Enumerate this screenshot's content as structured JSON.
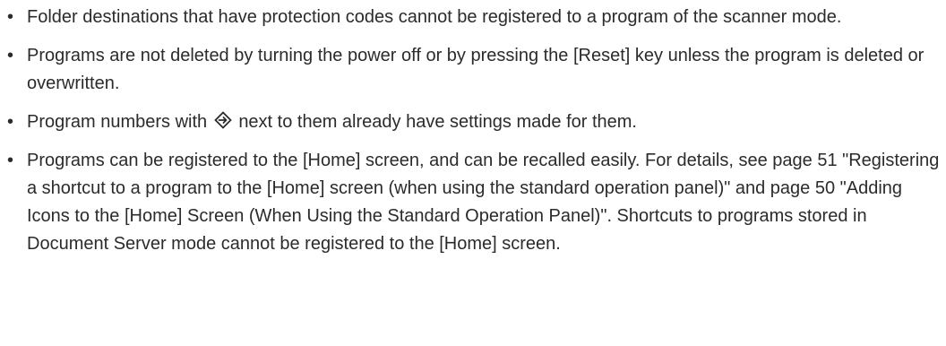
{
  "notes": [
    "Folder destinations that have protection codes cannot be registered to a program of the scanner mode.",
    "Programs are not deleted by turning the power off or by pressing the [Reset] key unless the program is deleted or overwritten.",
    {
      "before": "Program numbers with",
      "icon": "program-registered-icon",
      "after": "next to them already have settings made for them."
    },
    "Programs can be registered to the [Home] screen, and can be recalled easily. For details, see page 51 \"Registering a shortcut to a program to the [Home] screen (when using the standard operation panel)\" and page 50 \"Adding Icons to the [Home] Screen (When Using the Standard Operation Panel)\". Shortcuts to programs stored in Document Server mode cannot be registered to the [Home] screen."
  ],
  "bullet_glyph": "•"
}
